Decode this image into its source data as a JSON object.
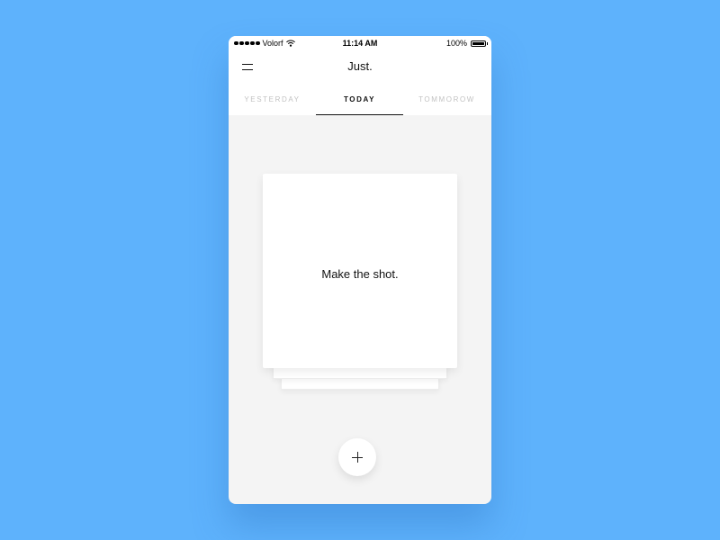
{
  "status_bar": {
    "carrier": "Volorf",
    "time": "11:14 AM",
    "battery": "100%",
    "signal_icon": "signal-dots-icon",
    "wifi_icon": "wifi-icon",
    "battery_icon": "battery-icon"
  },
  "nav": {
    "title": "Just.",
    "menu_icon": "hamburger-menu-icon"
  },
  "tabs": [
    {
      "label": "YESTERDAY",
      "active": false
    },
    {
      "label": "TODAY",
      "active": true
    },
    {
      "label": "TOMMOROW",
      "active": false
    }
  ],
  "card": {
    "text": "Make the shot."
  },
  "add_button": {
    "icon": "plus-icon"
  },
  "colors": {
    "background": "#5EB2FC",
    "screen": "#F4F4F4",
    "surface": "#FFFFFF",
    "active_text": "#111111",
    "inactive_tab": "#C2C2C2"
  }
}
